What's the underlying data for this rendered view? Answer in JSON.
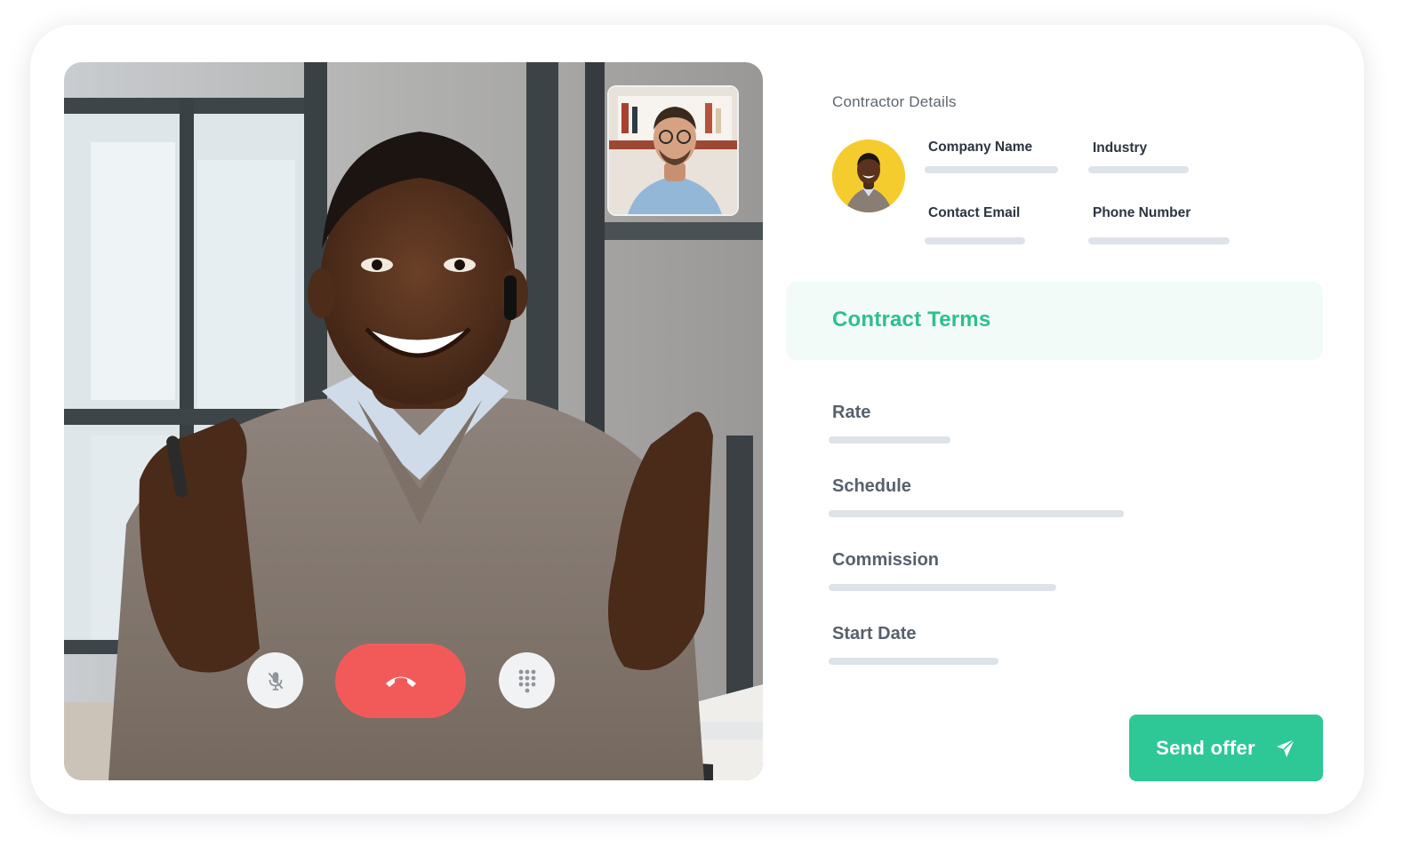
{
  "contractor": {
    "section_title": "Contractor Details",
    "fields": {
      "company_name": "Company Name",
      "industry": "Industry",
      "contact_email": "Contact Email",
      "phone_number": "Phone Number"
    }
  },
  "contract_terms": {
    "title": "Contract Terms",
    "items": {
      "rate": "Rate",
      "schedule": "Schedule",
      "commission": "Commission",
      "start_date": "Start Date"
    }
  },
  "call_controls": {
    "mute_icon": "mic-off-icon",
    "end_icon": "phone-hangup-icon",
    "keypad_icon": "dialpad-icon"
  },
  "send_offer": {
    "label": "Send offer",
    "icon": "send-icon"
  },
  "colors": {
    "accent": "#2dc895",
    "accent_text": "#2cc08e",
    "end_call": "#f25a5a",
    "avatar_bg": "#f5cc2e",
    "placeholder_bar": "#dde3e8"
  }
}
